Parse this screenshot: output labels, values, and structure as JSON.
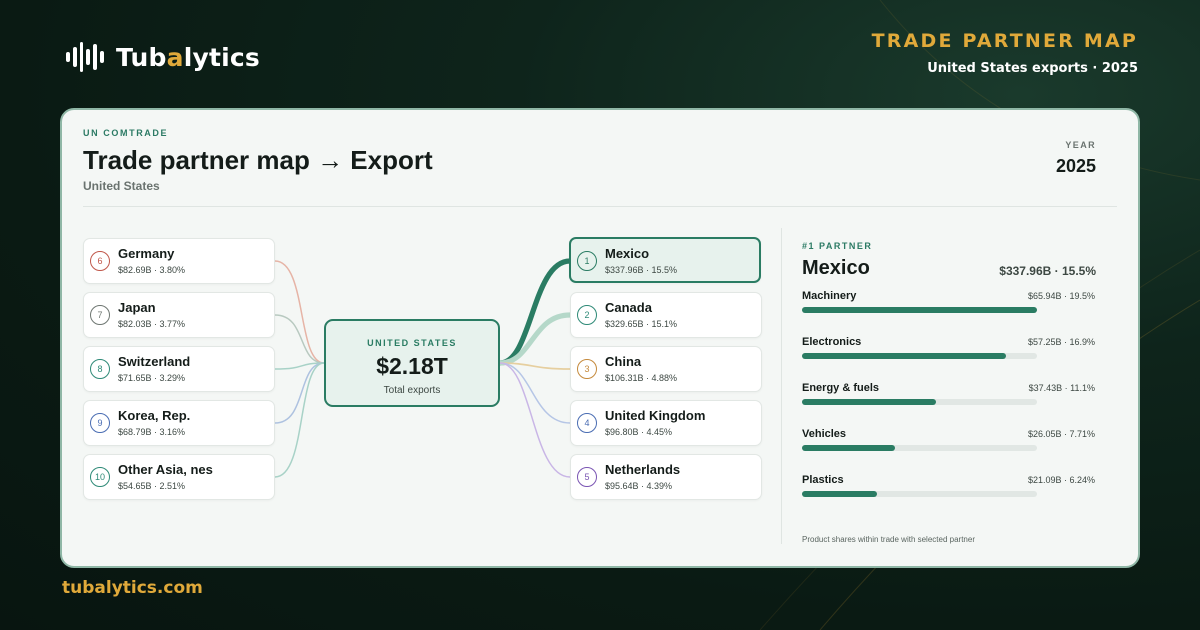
{
  "brand": {
    "prefix": "Tub",
    "accent": "a",
    "suffix": "lytics"
  },
  "header": {
    "title": "TRADE PARTNER MAP",
    "subtitle": "United States exports · 2025"
  },
  "footer": {
    "link": "tubalytics.com"
  },
  "card": {
    "source_label": "UN COMTRADE",
    "title": "Trade partner map → Export",
    "subtitle": "United States",
    "year_label": "YEAR",
    "year_value": "2025"
  },
  "center": {
    "label": "UNITED STATES",
    "value": "$2.18T",
    "sublabel": "Total exports"
  },
  "left_partners": [
    {
      "rank": "6",
      "name": "Germany",
      "value": "$82.69B · 3.80%",
      "color": "#c0574a"
    },
    {
      "rank": "7",
      "name": "Japan",
      "value": "$82.03B · 3.77%",
      "color": "#6f7772"
    },
    {
      "rank": "8",
      "name": "Switzerland",
      "value": "$71.65B · 3.29%",
      "color": "#2e8a77"
    },
    {
      "rank": "9",
      "name": "Korea, Rep.",
      "value": "$68.79B · 3.16%",
      "color": "#4a6db3"
    },
    {
      "rank": "10",
      "name": "Other Asia, nes",
      "value": "$54.65B · 2.51%",
      "color": "#2e8a77"
    }
  ],
  "right_partners": [
    {
      "rank": "1",
      "name": "Mexico",
      "value": "$337.96B · 15.5%",
      "color": "#2a7c63",
      "selected": true
    },
    {
      "rank": "2",
      "name": "Canada",
      "value": "$329.65B · 15.1%",
      "color": "#2e8a77",
      "selected": false
    },
    {
      "rank": "3",
      "name": "China",
      "value": "$106.31B · 4.88%",
      "color": "#c58a3c",
      "selected": false
    },
    {
      "rank": "4",
      "name": "United Kingdom",
      "value": "$96.80B · 4.45%",
      "color": "#4a6db3",
      "selected": false
    },
    {
      "rank": "5",
      "name": "Netherlands",
      "value": "$95.64B · 4.39%",
      "color": "#7a55b3",
      "selected": false
    }
  ],
  "left_flow_colors": [
    "#e6b4a6",
    "#b8c9c0",
    "#a8d2c7",
    "#aec2e0",
    "#a8d2c7"
  ],
  "right_flow_colors": [
    "#2a7c63",
    "#b5d8c9",
    "#e6cf9f",
    "#b6c6e6",
    "#c9b6e6"
  ],
  "right_flow_shares": [
    15.5,
    15.1,
    4.88,
    4.45,
    4.39
  ],
  "left_flow_shares": [
    3.8,
    3.77,
    3.29,
    3.16,
    2.51
  ],
  "top_partner": {
    "label": "#1 PARTNER",
    "name": "Mexico",
    "total": "$337.96B · 15.5%",
    "products": [
      {
        "name": "Machinery",
        "value": "$65.94B · 19.5%",
        "share": 19.5
      },
      {
        "name": "Electronics",
        "value": "$57.25B · 16.9%",
        "share": 16.9
      },
      {
        "name": "Energy & fuels",
        "value": "$37.43B · 11.1%",
        "share": 11.1
      },
      {
        "name": "Vehicles",
        "value": "$26.05B · 7.71%",
        "share": 7.71
      },
      {
        "name": "Plastics",
        "value": "$21.09B · 6.24%",
        "share": 6.24
      }
    ],
    "footnote": "Product shares within trade with selected partner"
  }
}
